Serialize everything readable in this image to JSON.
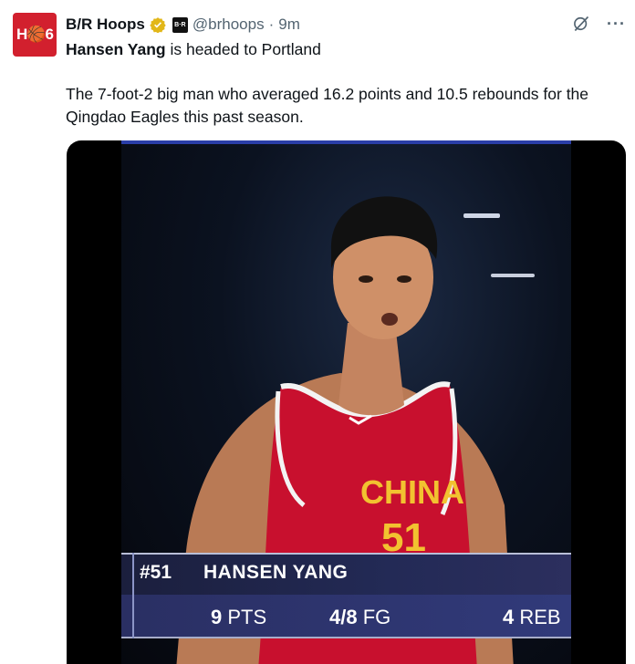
{
  "author": {
    "avatar_text": "H🏀6",
    "display_name": "B/R Hoops",
    "affiliate_badge": "B·R",
    "handle": "@brhoops",
    "separator": "·",
    "time": "9m"
  },
  "icons": {
    "grok": "grok-icon",
    "more": "more-icon",
    "verified": "verified-badge-icon"
  },
  "menu": {
    "more_label": "···"
  },
  "tweet": {
    "headline_name": "Hansen Yang",
    "headline_rest": " is headed to Portland",
    "body": "The 7-foot-2 big man who averaged 16.2 points and 10.5 rebounds for the Qingdao Eagles this past season."
  },
  "media": {
    "jersey_text": "CHINA",
    "jersey_number": "51",
    "scorebug": {
      "number": "#51",
      "name": "HANSEN YANG",
      "stat1_value": "9",
      "stat1_label": " PTS",
      "stat2_value": "4/8",
      "stat2_label": " FG",
      "stat3_value": "4",
      "stat3_label": " REB"
    }
  },
  "colors": {
    "avatar_bg": "#d2202e",
    "verified": "#e2b719",
    "jersey": "#c8102e",
    "scorebug": "#232a56"
  }
}
